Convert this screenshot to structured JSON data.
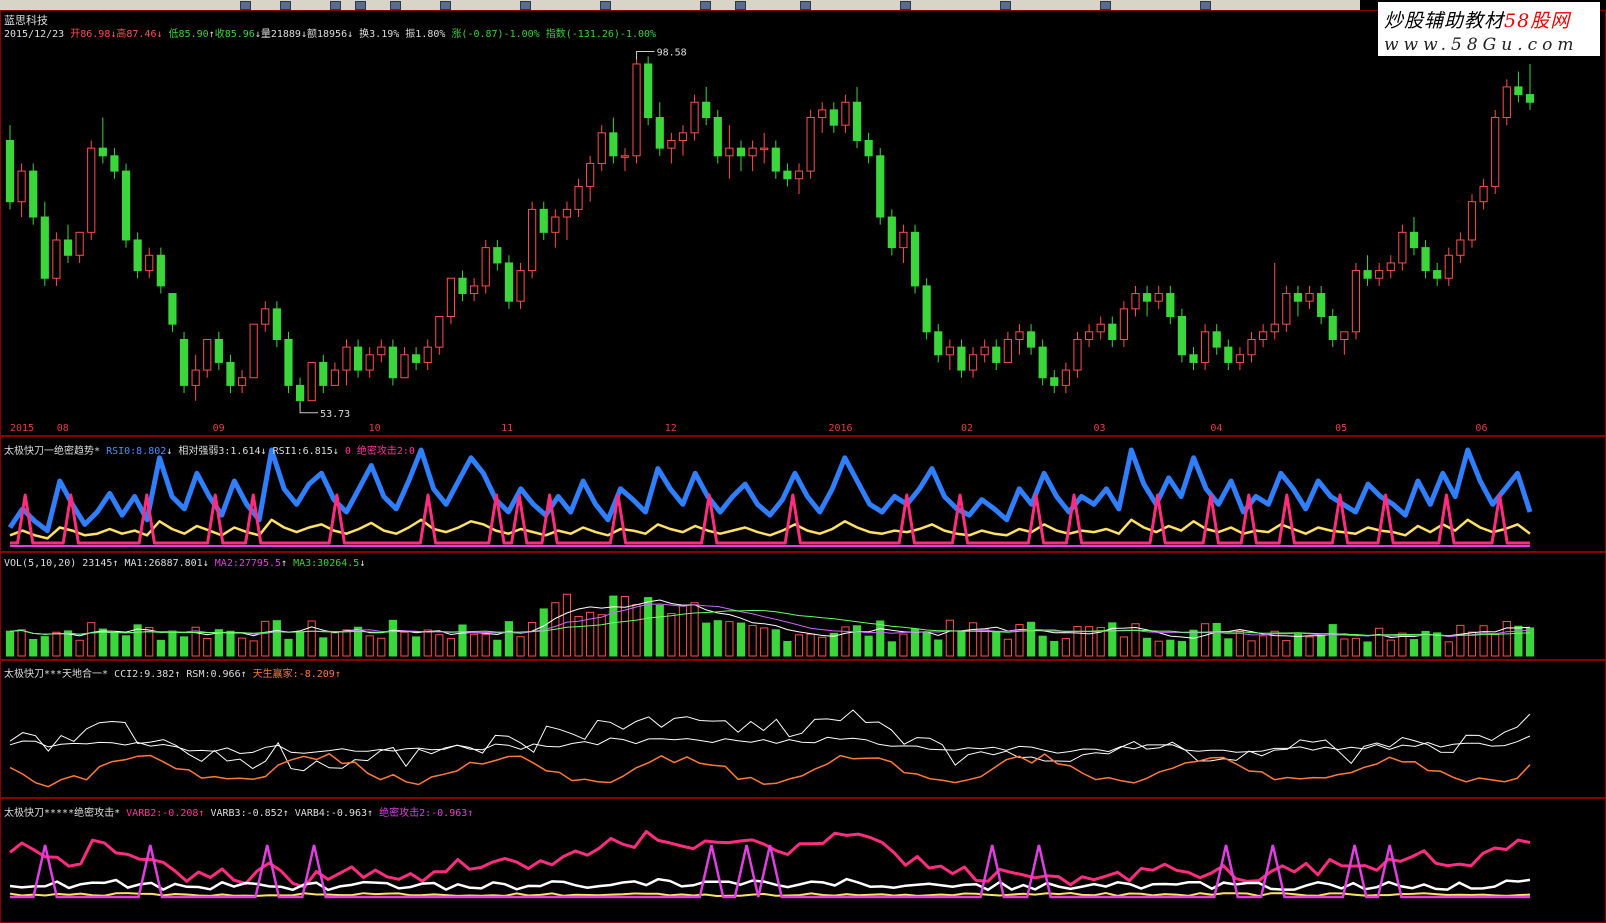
{
  "stock": {
    "name": "蓝思科技",
    "date": "2015/12/23",
    "open": "开86.98",
    "high": "高87.46",
    "low": "低85.90",
    "close": "收85.96",
    "volume": "量21889",
    "amount": "额18956",
    "turnover": "换3.19%",
    "amplitude": "振1.80%",
    "change": "涨(-0.87)-1.00%",
    "index": "指数(-131.26)-1.00%"
  },
  "watermark": {
    "line1_a": "炒股辅助教材",
    "line1_b": "58股网",
    "line2": "www.58Gu.com"
  },
  "indicators": {
    "ind1": {
      "name": "太极快刀一绝密趋势*",
      "rsi0": "RSI0:8.802",
      "rsi3": "相对强弱3:1.614",
      "rsi1": "RSI1:6.815",
      "attack": "0  绝密攻击2:0"
    },
    "vol": {
      "name": "VOL(5,10,20) 23145",
      "ma1": "MA1:26887.801",
      "ma2": "MA2:27795.5",
      "ma3": "MA3:30264.5"
    },
    "ind3": {
      "name": "太极快刀***天地合一*",
      "cci": "CCI2:9.382",
      "rsm": "RSM:0.966",
      "tian": "天生赢家:-8.209"
    },
    "ind4": {
      "name": "太极快刀*****绝密攻击*",
      "varb2": "VARB2:-0.208",
      "varb3": "VARB3:-0.852",
      "varb4": "VARB4:-0.963",
      "attack2": "绝密攻击2:-0.963"
    }
  },
  "chart_data": [
    {
      "type": "candlestick",
      "title": "蓝思科技",
      "price_annotations": [
        {
          "label": "98.58",
          "value": 98.58
        },
        {
          "label": "53.73",
          "value": 53.73
        }
      ],
      "ylim": [
        52,
        101
      ],
      "x_ticks": [
        "2015",
        "08",
        "09",
        "10",
        "11",
        "12",
        "2016",
        "02",
        "03",
        "04",
        "05",
        "06"
      ],
      "candles": [
        [
          88,
          90,
          79,
          80
        ],
        [
          80,
          85,
          78,
          84
        ],
        [
          84,
          85,
          77,
          78
        ],
        [
          78,
          80,
          69,
          70
        ],
        [
          70,
          76,
          69,
          75
        ],
        [
          75,
          77,
          72,
          73
        ],
        [
          73,
          76,
          72,
          76
        ],
        [
          76,
          88,
          75,
          87
        ],
        [
          87,
          91,
          85,
          86
        ],
        [
          86,
          87,
          83,
          84
        ],
        [
          84,
          85,
          74,
          75
        ],
        [
          75,
          76,
          70,
          71
        ],
        [
          71,
          74,
          70,
          73
        ],
        [
          73,
          74,
          68,
          69
        ],
        [
          68,
          68,
          63,
          64
        ],
        [
          62,
          63,
          55,
          56
        ],
        [
          56,
          60,
          54,
          58
        ],
        [
          58,
          62,
          57,
          62
        ],
        [
          62,
          63,
          58,
          59
        ],
        [
          59,
          60,
          55,
          56
        ],
        [
          56,
          58,
          55,
          57
        ],
        [
          57,
          64,
          57,
          64
        ],
        [
          64,
          67,
          63,
          66
        ],
        [
          66,
          67,
          61,
          62
        ],
        [
          62,
          63,
          55,
          56
        ],
        [
          56,
          57,
          53,
          54
        ],
        [
          54,
          59,
          54,
          59
        ],
        [
          59,
          60,
          55,
          56
        ],
        [
          56,
          59,
          56,
          58
        ],
        [
          58,
          62,
          56,
          61
        ],
        [
          61,
          62,
          57,
          58
        ],
        [
          58,
          61,
          57,
          60
        ],
        [
          60,
          62,
          59,
          61
        ],
        [
          61,
          62,
          56,
          57
        ],
        [
          57,
          61,
          57,
          60
        ],
        [
          60,
          61,
          58,
          59
        ],
        [
          59,
          62,
          58,
          61
        ],
        [
          61,
          65,
          60,
          65
        ],
        [
          65,
          70,
          64,
          70
        ],
        [
          70,
          71,
          67,
          68
        ],
        [
          68,
          70,
          67,
          69
        ],
        [
          69,
          75,
          68,
          74
        ],
        [
          74,
          75,
          71,
          72
        ],
        [
          72,
          73,
          66,
          67
        ],
        [
          67,
          72,
          66,
          71
        ],
        [
          71,
          80,
          70,
          79
        ],
        [
          79,
          80,
          75,
          76
        ],
        [
          76,
          79,
          74,
          78
        ],
        [
          78,
          80,
          75,
          79
        ],
        [
          79,
          83,
          78,
          82
        ],
        [
          82,
          86,
          80,
          85
        ],
        [
          85,
          90,
          84,
          89
        ],
        [
          89,
          91,
          85,
          86
        ],
        [
          86,
          87,
          84,
          86
        ],
        [
          86,
          99,
          85,
          98
        ],
        [
          98,
          99,
          90,
          91
        ],
        [
          91,
          93,
          86,
          87
        ],
        [
          87,
          89,
          85,
          88
        ],
        [
          88,
          90,
          86,
          89
        ],
        [
          89,
          94,
          88,
          93
        ],
        [
          93,
          95,
          90,
          91
        ],
        [
          91,
          92,
          85,
          86
        ],
        [
          86,
          90,
          83,
          87
        ],
        [
          87,
          88,
          84,
          86
        ],
        [
          86,
          88,
          84,
          87
        ],
        [
          87,
          89,
          85,
          87
        ],
        [
          87,
          88,
          83,
          84
        ],
        [
          84,
          85,
          82,
          83
        ],
        [
          83,
          85,
          81,
          84
        ],
        [
          84,
          92,
          83,
          91
        ],
        [
          91,
          93,
          89,
          92
        ],
        [
          92,
          93,
          89,
          90
        ],
        [
          90,
          94,
          89,
          93
        ],
        [
          93,
          95,
          87,
          88
        ],
        [
          88,
          89,
          85,
          86
        ],
        [
          86,
          87,
          77,
          78
        ],
        [
          78,
          79,
          73,
          74
        ],
        [
          74,
          77,
          72,
          76
        ],
        [
          76,
          77,
          68,
          69
        ],
        [
          69,
          70,
          62,
          63
        ],
        [
          63,
          64,
          59,
          60
        ],
        [
          60,
          62,
          58,
          61
        ],
        [
          61,
          62,
          57,
          58
        ],
        [
          58,
          61,
          57,
          60
        ],
        [
          60,
          62,
          59,
          61
        ],
        [
          61,
          62,
          58,
          59
        ],
        [
          59,
          63,
          59,
          62
        ],
        [
          62,
          64,
          60,
          63
        ],
        [
          63,
          64,
          60,
          61
        ],
        [
          61,
          62,
          56,
          57
        ],
        [
          57,
          58,
          55,
          56
        ],
        [
          56,
          59,
          55,
          58
        ],
        [
          58,
          63,
          57,
          62
        ],
        [
          62,
          64,
          61,
          63
        ],
        [
          63,
          65,
          62,
          64
        ],
        [
          64,
          65,
          61,
          62
        ],
        [
          62,
          67,
          61,
          66
        ],
        [
          66,
          69,
          65,
          68
        ],
        [
          68,
          69,
          65,
          67
        ],
        [
          67,
          69,
          66,
          68
        ],
        [
          68,
          69,
          64,
          65
        ],
        [
          65,
          66,
          59,
          60
        ],
        [
          60,
          61,
          58,
          59
        ],
        [
          59,
          64,
          58,
          63
        ],
        [
          63,
          64,
          60,
          61
        ],
        [
          61,
          62,
          58,
          59
        ],
        [
          59,
          61,
          58,
          60
        ],
        [
          60,
          63,
          59,
          62
        ],
        [
          62,
          64,
          61,
          63
        ],
        [
          63,
          72,
          62,
          64
        ],
        [
          64,
          69,
          63,
          68
        ],
        [
          68,
          69,
          65,
          67
        ],
        [
          67,
          69,
          66,
          68
        ],
        [
          68,
          69,
          64,
          65
        ],
        [
          65,
          66,
          61,
          62
        ],
        [
          62,
          63,
          60,
          63
        ],
        [
          63,
          72,
          62,
          71
        ],
        [
          71,
          73,
          69,
          70
        ],
        [
          70,
          72,
          69,
          71
        ],
        [
          71,
          73,
          70,
          72
        ],
        [
          72,
          77,
          71,
          76
        ],
        [
          76,
          78,
          73,
          74
        ],
        [
          74,
          75,
          70,
          71
        ],
        [
          71,
          72,
          69,
          70
        ],
        [
          70,
          74,
          69,
          73
        ],
        [
          73,
          76,
          72,
          75
        ],
        [
          75,
          81,
          74,
          80
        ],
        [
          80,
          83,
          79,
          82
        ],
        [
          82,
          92,
          81,
          91
        ],
        [
          91,
          96,
          90,
          95
        ],
        [
          95,
          97,
          93,
          94
        ],
        [
          94,
          98,
          92,
          93
        ]
      ]
    },
    {
      "type": "line",
      "title": "太极快刀一绝密趋势*",
      "series": [
        {
          "name": "RSI0",
          "color": "#2f7fff",
          "values": [
            10,
            22,
            14,
            8,
            40,
            25,
            12,
            20,
            32,
            18,
            30,
            15,
            55,
            30,
            22,
            45,
            30,
            18,
            40,
            25,
            15,
            60,
            35,
            25,
            38,
            45,
            28,
            20,
            35,
            50,
            30,
            22,
            40,
            60,
            35,
            25,
            40,
            55,
            45,
            28,
            20,
            35,
            25,
            18,
            30,
            20,
            40,
            25,
            15,
            35,
            28,
            20,
            48,
            35,
            25,
            45,
            30,
            20,
            30,
            38,
            25,
            18,
            28,
            45,
            30,
            20,
            35,
            55,
            40,
            25,
            20,
            30,
            25,
            35,
            48,
            30,
            22,
            18,
            28,
            22,
            15,
            35,
            25,
            45,
            30,
            20,
            30,
            25,
            35,
            22,
            60,
            38,
            25,
            42,
            30,
            55,
            35,
            25,
            40,
            20,
            30,
            25,
            45,
            35,
            22,
            40,
            30,
            25,
            20,
            38,
            30,
            25,
            18,
            40,
            25,
            45,
            30,
            60,
            40,
            25,
            35,
            45,
            20
          ]
        },
        {
          "name": "相对强弱3",
          "color": "#ffe066",
          "values": [
            5,
            8,
            5,
            3,
            10,
            8,
            5,
            6,
            9,
            6,
            8,
            5,
            14,
            9,
            6,
            11,
            8,
            5,
            10,
            7,
            5,
            15,
            10,
            7,
            10,
            12,
            8,
            6,
            9,
            13,
            8,
            6,
            10,
            15,
            9,
            7,
            10,
            14,
            12,
            8,
            6,
            9,
            7,
            5,
            8,
            6,
            10,
            7,
            5,
            9,
            8,
            6,
            12,
            9,
            7,
            11,
            8,
            6,
            8,
            10,
            7,
            5,
            8,
            12,
            8,
            6,
            9,
            14,
            10,
            7,
            6,
            8,
            7,
            9,
            12,
            8,
            6,
            5,
            8,
            6,
            5,
            9,
            7,
            12,
            8,
            6,
            8,
            7,
            9,
            6,
            15,
            10,
            7,
            11,
            8,
            14,
            9,
            7,
            10,
            6,
            8,
            7,
            12,
            9,
            6,
            10,
            8,
            7,
            6,
            10,
            8,
            7,
            5,
            11,
            7,
            12,
            8,
            15,
            10,
            7,
            9,
            12,
            6
          ]
        },
        {
          "name": "绝密攻击2",
          "color": "#ff2d80",
          "spikes": [
            2,
            8,
            18,
            27,
            32,
            43,
            55,
            64,
            67,
            71,
            80,
            92,
            103,
            118,
            125,
            135,
            140,
            151,
            158,
            163,
            168,
            175,
            181,
            189,
            196
          ]
        }
      ]
    },
    {
      "type": "bar",
      "title": "VOL(5,10,20)",
      "series": [
        {
          "name": "MA1",
          "color": "#ffffff"
        },
        {
          "name": "MA2",
          "color": "#cc66ff"
        },
        {
          "name": "MA3",
          "color": "#66ff66"
        }
      ]
    },
    {
      "type": "line",
      "title": "太极快刀***天地合一*",
      "series": [
        {
          "name": "CCI2",
          "color": "#ffffff"
        },
        {
          "name": "RSM",
          "color": "#ffffff"
        },
        {
          "name": "天生赢家",
          "color": "#ff7a3a"
        }
      ]
    },
    {
      "type": "line",
      "title": "太极快刀*****绝密攻击*",
      "series": [
        {
          "name": "VARB2",
          "color": "#ff2d80"
        },
        {
          "name": "VARB3",
          "color": "#ffffff"
        },
        {
          "name": "VARB4",
          "color": "#ffe066"
        },
        {
          "name": "绝密攻击2",
          "color": "#e040e0"
        }
      ]
    }
  ]
}
